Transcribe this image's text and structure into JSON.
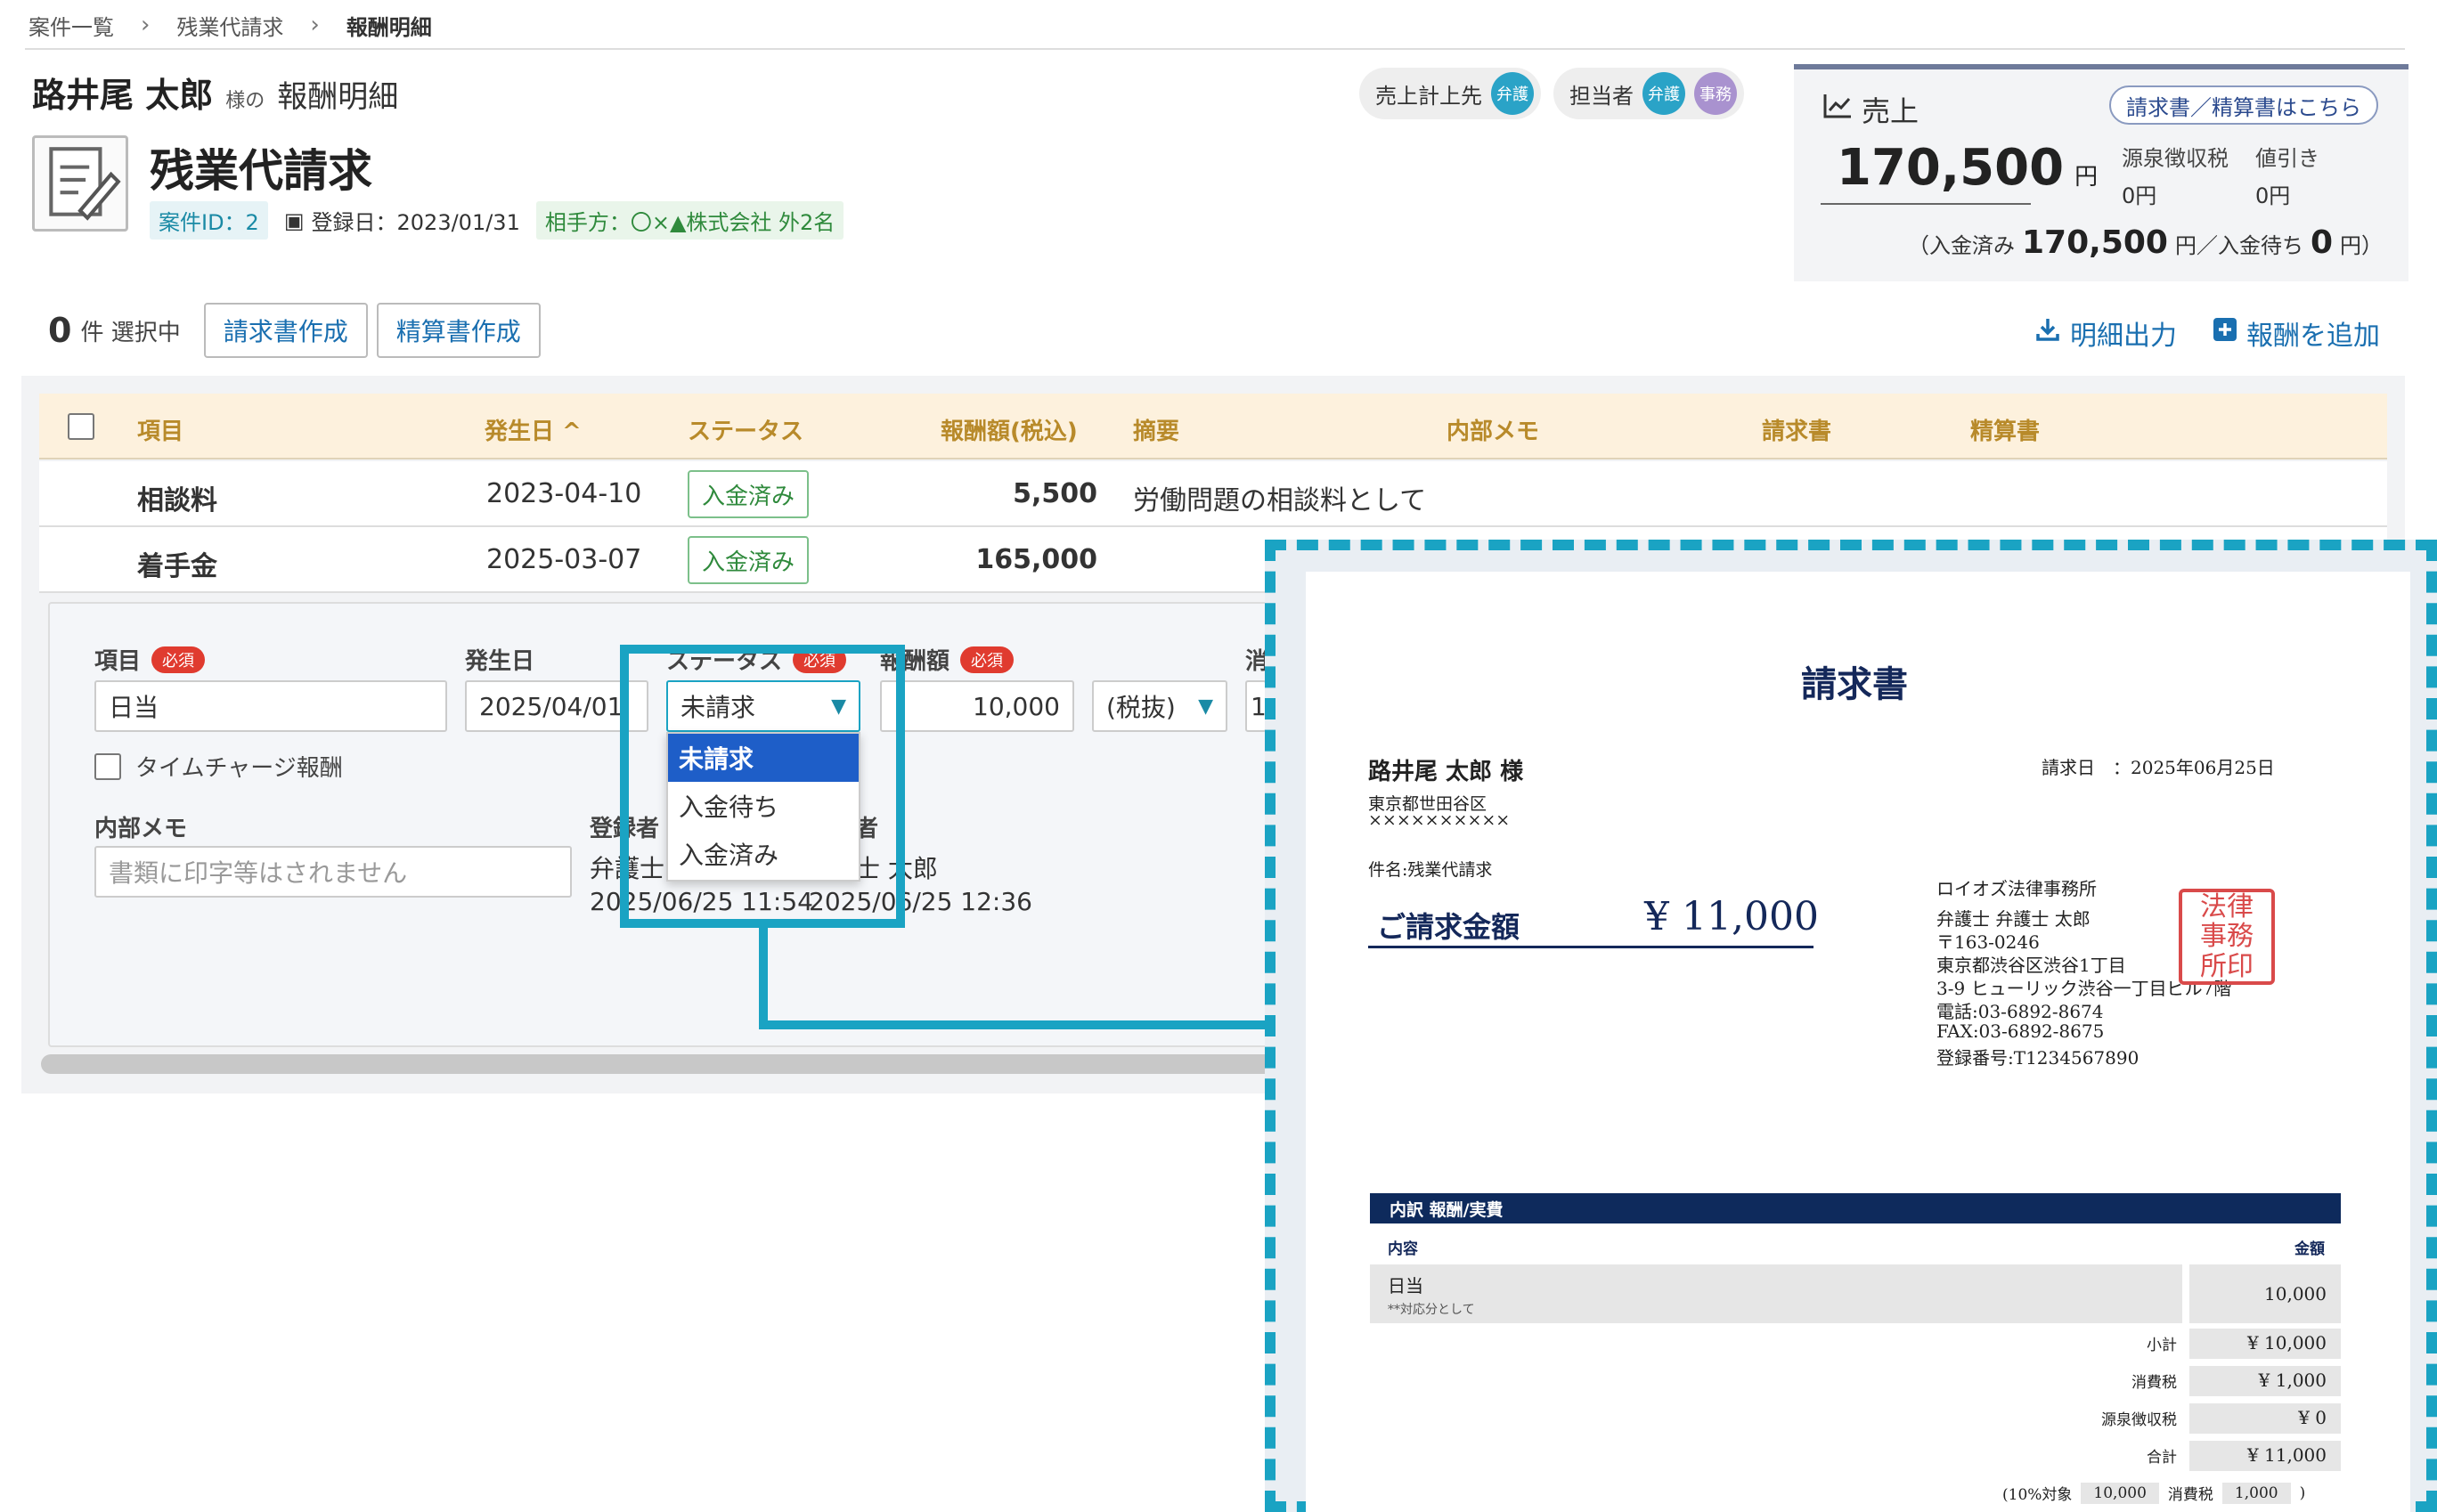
{
  "breadcrumb": {
    "items": [
      "案件一覧",
      "残業代請求",
      "報酬明細"
    ]
  },
  "header": {
    "client_name": "路井尾 太郎",
    "honorific": "様の",
    "page_title": "報酬明細",
    "case_title": "残業代請求",
    "case_id": "案件ID：2",
    "registered_date": "登録日：2023/01/31",
    "counterparty": "相手方：〇×▲株式会社 外2名",
    "sales_recorder_label": "売上計上先",
    "sales_recorder_badge": "弁護",
    "assignee_label": "担当者",
    "assignee_badges": [
      "弁護",
      "事務"
    ]
  },
  "sales": {
    "label": "売上",
    "invoice_link": "請求書／精算書はこちら",
    "amount": "170,500",
    "yen": "円",
    "withholding_label": "源泉徴収税",
    "withholding_value": "0円",
    "discount_label": "値引き",
    "discount_value": "0円",
    "paid_open": "（入金済み",
    "paid_amount": "170,500",
    "paid_yen": "円／入金待ち",
    "pending_amount": "0",
    "pending_close": "円）"
  },
  "toolbar": {
    "selected_count": "0",
    "selected_label": "件 選択中",
    "create_invoice": "請求書作成",
    "create_settlement": "精算書作成",
    "export": "明細出力",
    "add_fee": "報酬を追加"
  },
  "table": {
    "headers": [
      "項目",
      "発生日 ^",
      "ステータス",
      "報酬額(税込)",
      "摘要",
      "内部メモ",
      "請求書",
      "精算書"
    ],
    "rows": [
      {
        "item": "相談料",
        "date": "2023-04-10",
        "status": "入金済み",
        "amount": "5,500",
        "summary": "労働問題の相談料として"
      },
      {
        "item": "着手金",
        "date": "2025-03-07",
        "status": "入金済み",
        "amount": "165,000",
        "summary": ""
      }
    ]
  },
  "form": {
    "item_label": "項目",
    "required": "必須",
    "item_value": "日当",
    "date_label": "発生日",
    "date_value": "2025/04/01",
    "status_label": "ステータス",
    "status_value": "未請求",
    "amount_label": "報酬額",
    "amount_value": "10,000",
    "tax_value": "(税抜)",
    "tax_next_label": "消",
    "tax_next_value": "1",
    "timecharge_label": "タイムチャージ報酬",
    "memo_label": "内部メモ",
    "memo_placeholder": "書類に印字等はされません",
    "registrant_label": "登録者",
    "registrant_value": "弁護士",
    "registered_at": "2025/06/25 11:54",
    "updater_label": "者",
    "updater_value": "士 太郎",
    "updated_at": "2025/06/25 12:36",
    "status_options": [
      "未請求",
      "入金待ち",
      "入金済み"
    ]
  },
  "invoice": {
    "title": "請求書",
    "client": "路井尾 太郎 様",
    "client_addr1": "東京都世田谷区",
    "client_addr2": "××××××××××",
    "date": "請求日　：2025年06月25日",
    "subject": "件名:残業代請求",
    "amount_label": "ご請求金額",
    "amount_value": "¥ 11,000",
    "firm": "ロイオズ法律事務所",
    "lawyer": "弁護士 弁護士 太郎",
    "zip": "〒163-0246",
    "addr1": "東京都渋谷区渋谷1丁目",
    "addr2": "3-9 ヒューリック渋谷一丁目ビル7階",
    "tel": "電話:03-6892-8674",
    "fax": "FAX:03-6892-8675",
    "reg_no": "登録番号:T1234567890",
    "stamp": "法律事務所印",
    "table_title": "内訳 報酬/実費",
    "col_content": "内容",
    "col_amount": "金額",
    "line_item": "日当",
    "line_note": "**対応分として",
    "line_amount": "10,000",
    "subtotal_label": "小計",
    "subtotal": "¥ 10,000",
    "tax_label": "消費税",
    "tax": "¥ 1,000",
    "withholding_label": "源泉徴収税",
    "withholding": "¥ 0",
    "total_label": "合計",
    "total": "¥ 11,000",
    "footer_open": "(10%対象",
    "footer_base": "10,000",
    "footer_tax_label": "消費税",
    "footer_tax": "1,000",
    "footer_close": ")"
  },
  "colors": {
    "accent": "#1aa3c3",
    "link": "#1a6fb0",
    "header_bg": "#fdf1dd",
    "header_text": "#b88a2a",
    "required": "#e03b2f",
    "navy": "#0e2a5c"
  }
}
